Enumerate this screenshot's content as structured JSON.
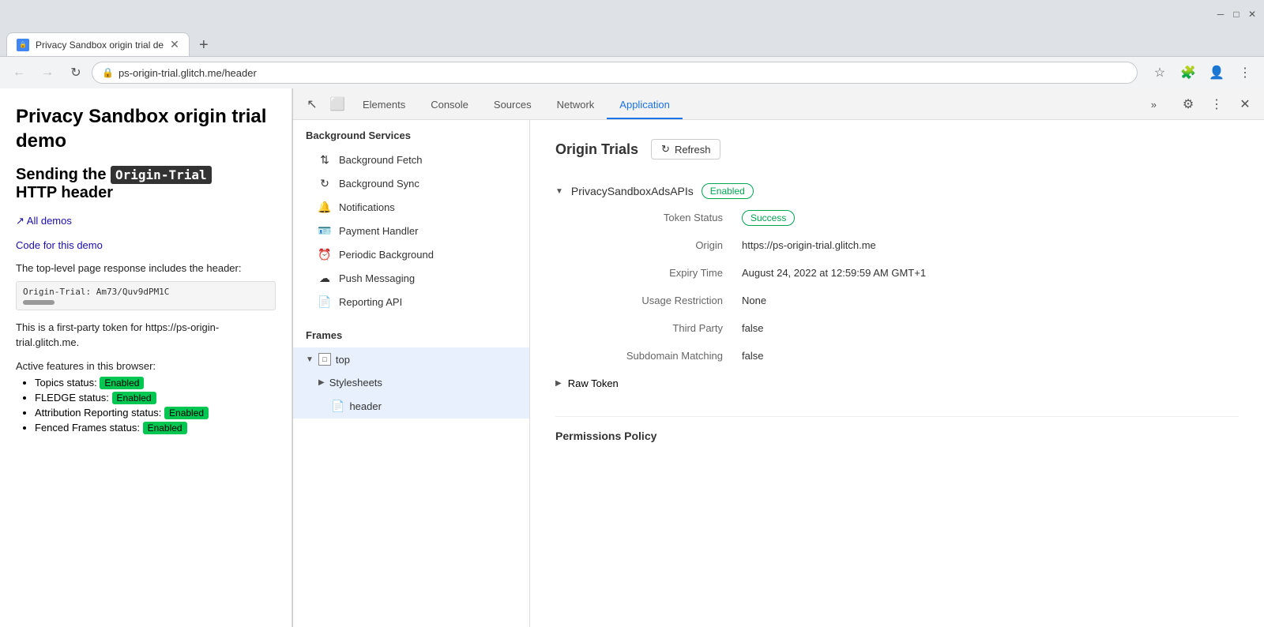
{
  "browser": {
    "tab_title": "Privacy Sandbox origin trial de",
    "address": "ps-origin-trial.glitch.me/header",
    "new_tab_label": "+"
  },
  "nav": {
    "back_label": "←",
    "forward_label": "→",
    "refresh_label": "↻",
    "home_label": "⌂"
  },
  "webpage": {
    "title": "Privacy Sandbox origin trial demo",
    "subtitle_text": "Sending the",
    "subtitle_code": "Origin-Trial",
    "subtitle_suffix": "HTTP header",
    "link_all_demos": "↗ All demos",
    "link_code": "Code for this demo",
    "text_before_header": "The top-level page response includes the header:",
    "header_value": "Origin-Trial: Am73/Quv9dPM1C",
    "first_party_text": "This is a first-party token for https://ps-origin-trial.glitch.me.",
    "active_features_text": "Active features in this browser:",
    "features": [
      {
        "label": "Topics status:",
        "badge": "Enabled"
      },
      {
        "label": "FLEDGE status:",
        "badge": "Enabled"
      },
      {
        "label": "Attribution Reporting status:",
        "badge": "Enabled"
      },
      {
        "label": "Fenced Frames status:",
        "badge": "Enabled"
      }
    ]
  },
  "devtools": {
    "tabs": [
      {
        "id": "elements",
        "label": "Elements"
      },
      {
        "id": "console",
        "label": "Console"
      },
      {
        "id": "sources",
        "label": "Sources"
      },
      {
        "id": "network",
        "label": "Network"
      },
      {
        "id": "application",
        "label": "Application"
      }
    ],
    "active_tab": "application",
    "more_label": "»",
    "sidebar": {
      "background_services_title": "Background Services",
      "items": [
        {
          "id": "bg-fetch",
          "icon": "⇅",
          "label": "Background Fetch"
        },
        {
          "id": "bg-sync",
          "icon": "↻",
          "label": "Background Sync"
        },
        {
          "id": "notifications",
          "icon": "🔔",
          "label": "Notifications"
        },
        {
          "id": "payment-handler",
          "icon": "🪪",
          "label": "Payment Handler"
        },
        {
          "id": "periodic-bg",
          "icon": "⏰",
          "label": "Periodic Background"
        },
        {
          "id": "push-messaging",
          "icon": "☁",
          "label": "Push Messaging"
        },
        {
          "id": "reporting-api",
          "icon": "📄",
          "label": "Reporting API"
        }
      ],
      "frames_title": "Frames",
      "top_frame": "top",
      "stylesheets_item": "Stylesheets",
      "header_item": "header"
    },
    "content": {
      "section_title": "Origin Trials",
      "refresh_label": "Refresh",
      "trial_name": "PrivacySandboxAdsAPIs",
      "trial_status": "Enabled",
      "token_status_label": "Token Status",
      "token_status_value": "Success",
      "origin_label": "Origin",
      "origin_value": "https://ps-origin-trial.glitch.me",
      "expiry_label": "Expiry Time",
      "expiry_value": "August 24, 2022 at 12:59:59 AM GMT+1",
      "usage_restriction_label": "Usage Restriction",
      "usage_restriction_value": "None",
      "third_party_label": "Third Party",
      "third_party_value": "false",
      "subdomain_label": "Subdomain Matching",
      "subdomain_value": "false",
      "raw_token_label": "Raw Token",
      "permissions_title": "Permissions Policy"
    }
  }
}
